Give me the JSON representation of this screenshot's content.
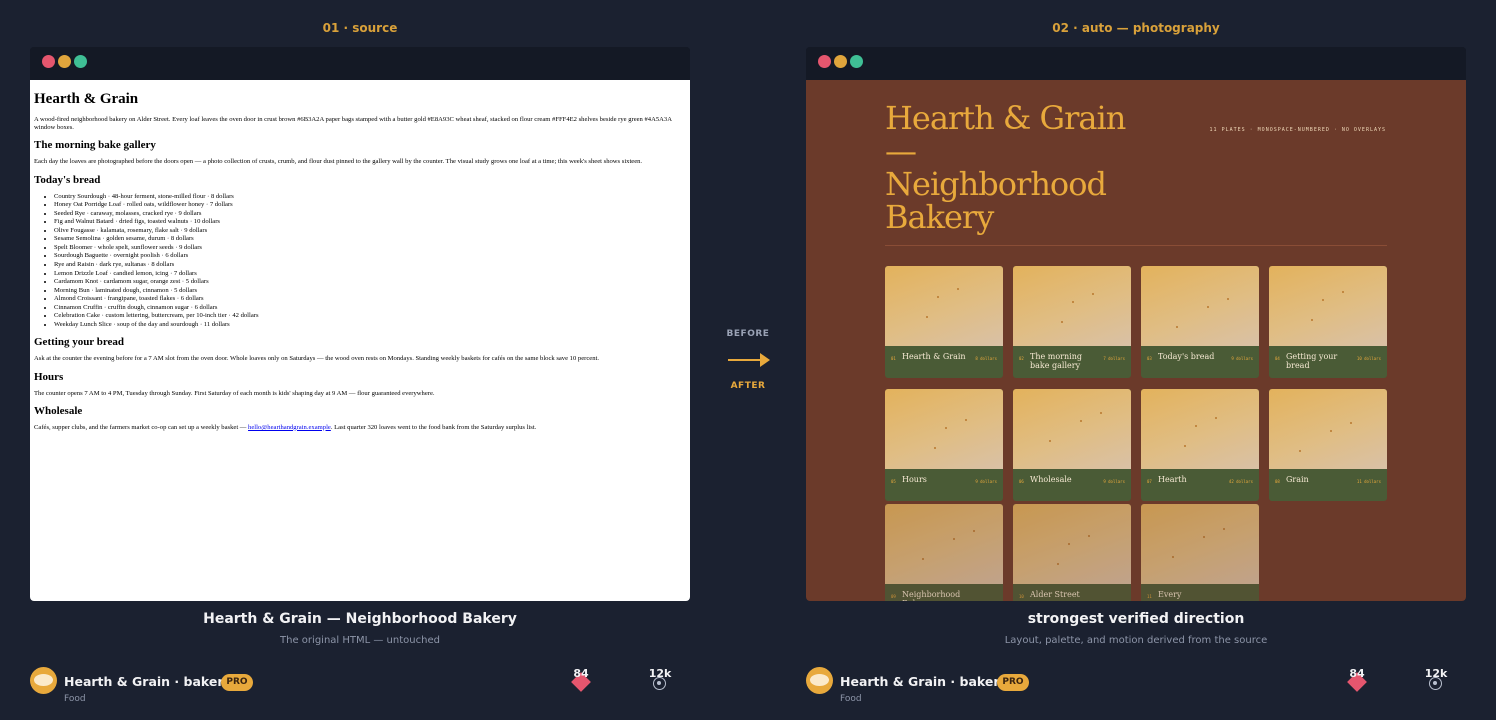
{
  "left_panel": {
    "label": "01 · source",
    "caption_title": "Hearth & Grain — Neighborhood Bakery",
    "caption_sub": "The original HTML — untouched"
  },
  "right_panel": {
    "label": "02 · auto — photography",
    "caption_title": "strongest verified direction",
    "caption_sub": "Layout, palette, and motion derived from the source"
  },
  "transition": {
    "before": "BEFORE",
    "after": "AFTER"
  },
  "source_page": {
    "h1": "Hearth & Grain",
    "intro": "A wood-fired neighborhood bakery on Alder Street. Every loaf leaves the oven door in crust brown #6B3A2A paper bags stamped with a butter gold #E8A93C wheat sheaf, stacked on flour cream #FFF4E2 shelves beside rye green #4A5A3A window boxes.",
    "gallery_heading": "The morning bake gallery",
    "gallery_text": "Each day the loaves are photographed before the doors open — a photo collection of crusts, crumb, and flour dust pinned to the gallery wall by the counter. The visual study grows one loaf at a time; this week's sheet shows sixteen.",
    "bread_heading": "Today's bread",
    "breads": [
      "Country Sourdough · 48-hour ferment, stone-milled flour · 8 dollars",
      "Honey Oat Porridge Loaf · rolled oats, wildflower honey · 7 dollars",
      "Seeded Rye · caraway, molasses, cracked rye · 9 dollars",
      "Fig and Walnut Batard · dried figs, toasted walnuts · 10 dollars",
      "Olive Fougasse · kalamata, rosemary, flake salt · 9 dollars",
      "Sesame Semolina · golden sesame, durum · 8 dollars",
      "Spelt Bloomer · whole spelt, sunflower seeds · 9 dollars",
      "Sourdough Baguette · overnight poolish · 6 dollars",
      "Rye and Raisin · dark rye, sultanas · 8 dollars",
      "Lemon Drizzle Loaf · candied lemon, icing · 7 dollars",
      "Cardamom Knot · cardamom sugar, orange zest · 5 dollars",
      "Morning Bun · laminated dough, cinnamon · 5 dollars",
      "Almond Croissant · frangipane, toasted flakes · 6 dollars",
      "Cinnamon Cruffin · cruffin dough, cinnamon sugar · 6 dollars",
      "Celebration Cake · custom lettering, buttercream, per 10-inch tier · 42 dollars",
      "Weekday Lunch Slice · soup of the day and sourdough · 11 dollars"
    ],
    "getting_heading": "Getting your bread",
    "getting_text": "Ask at the counter the evening before for a 7 AM slot from the oven door. Whole loaves only on Saturdays — the wood oven rests on Mondays. Standing weekly baskets for cafés on the same block save 10 percent.",
    "hours_heading": "Hours",
    "hours_text": "The counter opens 7 AM to 4 PM, Tuesday through Sunday. First Saturday of each month is kids' shaping day at 9 AM — flour guaranteed everywhere.",
    "wholesale_heading": "Wholesale",
    "wholesale_before": "Cafés, supper clubs, and the farmers market co-op can set up a weekly basket — ",
    "wholesale_link": "hello@hearthandgrain.example",
    "wholesale_after": ". Last quarter 320 loaves went to the food bank from the Saturday surplus list."
  },
  "styled_page": {
    "title": "Hearth & Grain — Neighborhood Bakery",
    "meta": "11 PLATES · MONOSPACE-NUMBERED · NO OVERLAYS",
    "plates": [
      {
        "num": "01",
        "name": "Hearth & Grain",
        "price": "8 dollars"
      },
      {
        "num": "02",
        "name": "The morning bake gallery",
        "price": "7 dollars"
      },
      {
        "num": "03",
        "name": "Today's bread",
        "price": "9 dollars"
      },
      {
        "num": "04",
        "name": "Getting your bread",
        "price": "10 dollars"
      },
      {
        "num": "05",
        "name": "Hours",
        "price": "9 dollars"
      },
      {
        "num": "06",
        "name": "Wholesale",
        "price": "9 dollars"
      },
      {
        "num": "07",
        "name": "Hearth",
        "price": "42 dollars"
      },
      {
        "num": "08",
        "name": "Grain",
        "price": "11 dollars"
      },
      {
        "num": "09",
        "name": "Neighborhood Bakery",
        "price": ""
      },
      {
        "num": "10",
        "name": "Alder Street",
        "price": ""
      },
      {
        "num": "11",
        "name": "Every",
        "price": ""
      }
    ]
  },
  "author": {
    "name": "Hearth & Grain · bakery",
    "badge": "PRO",
    "category": "Food",
    "likes": "84",
    "views": "12k"
  },
  "colors": {
    "background": "#1b2130",
    "accent": "#e8a93c",
    "crust_brown": "#6b3a2a",
    "rye_green": "#4a5b36"
  }
}
